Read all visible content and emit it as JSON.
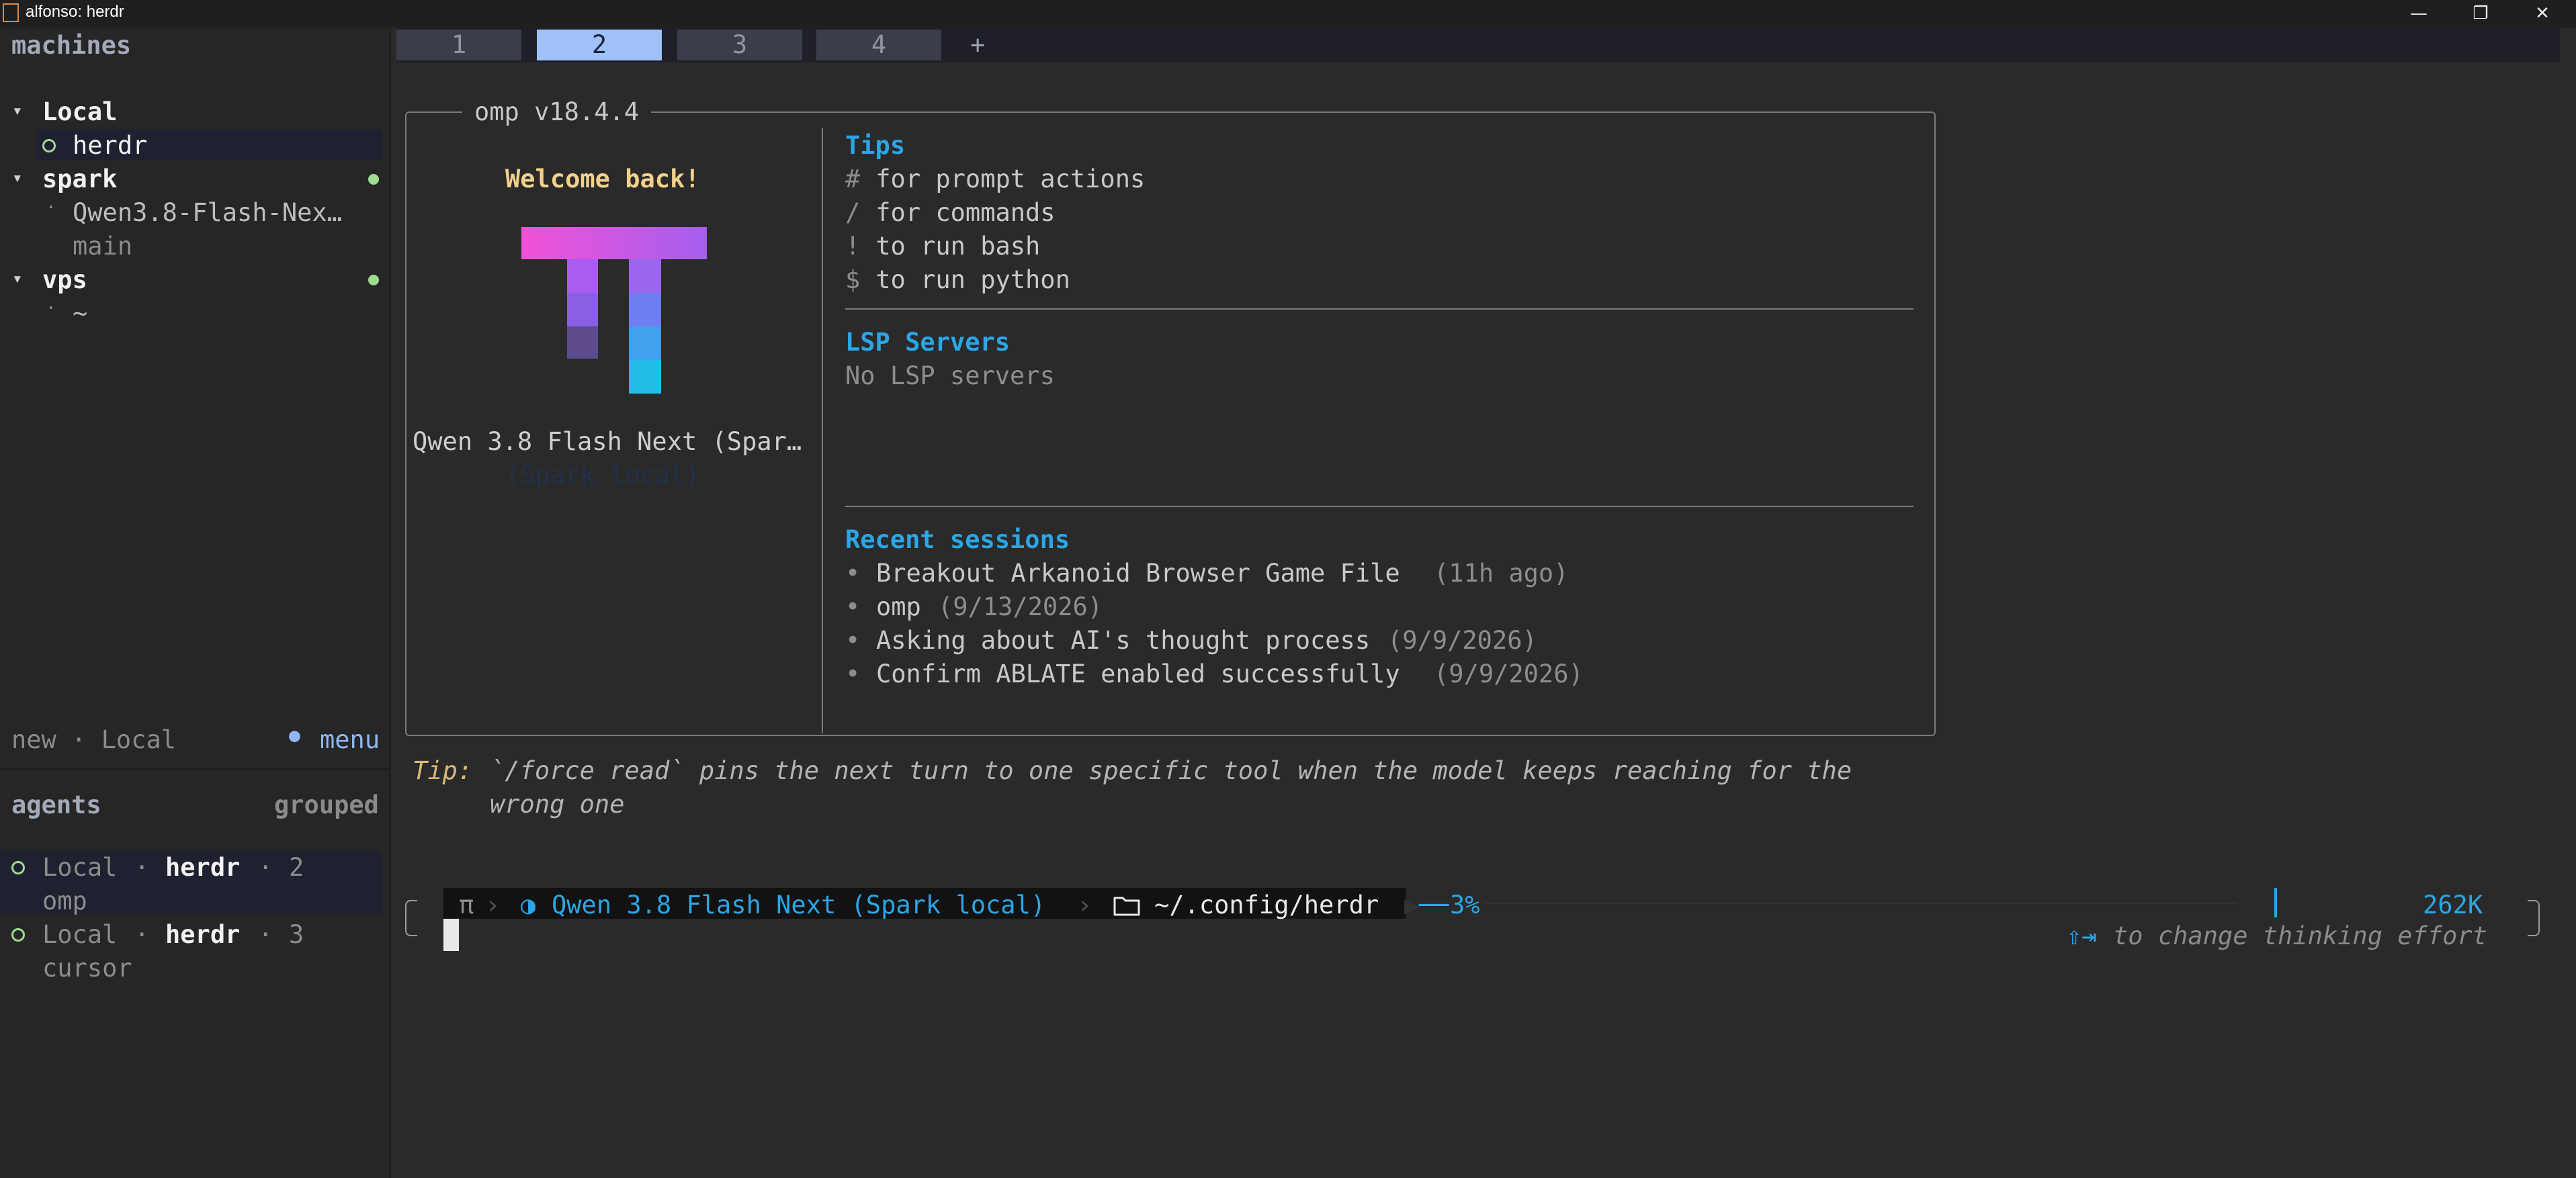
{
  "window": {
    "title": "alfonso: herdr",
    "controls": [
      "—",
      "❐",
      "✕"
    ]
  },
  "sidebar": {
    "machines_header": "machines",
    "groups": [
      {
        "caret": "▾",
        "name": "Local",
        "items": [
          {
            "glyph": "○",
            "label": "herdr"
          }
        ]
      },
      {
        "caret": "▾",
        "name": "spark",
        "items": [
          {
            "glyph": "·",
            "label": "Qwen3.8-Flash-Nex…"
          },
          {
            "glyph": "",
            "label": "main"
          }
        ]
      },
      {
        "caret": "▾",
        "name": "vps",
        "items": [
          {
            "glyph": "·",
            "label": "~"
          }
        ]
      }
    ],
    "footer": {
      "new_label": "new · Local",
      "menu_glyph": "●",
      "menu_label": "menu"
    },
    "agents_header": "agents",
    "agents_mode": "grouped",
    "agents": [
      {
        "glyph": "○",
        "machine": "Local",
        "sep": "·",
        "host": "herdr",
        "sep2": "·",
        "num": "2",
        "name": "omp"
      },
      {
        "glyph": "○",
        "machine": "Local",
        "sep": "·",
        "host": "herdr",
        "sep2": "·",
        "num": "3",
        "name": "cursor"
      }
    ]
  },
  "tabs": {
    "items": [
      "1",
      "2",
      "3",
      "4"
    ],
    "active": "2",
    "add": "+"
  },
  "panel": {
    "title": "omp v18.4.4",
    "welcome": "Welcome back!",
    "model": "Qwen 3.8 Flash Next (Spar…",
    "model_sub": "(Spark local)",
    "tips_header": "Tips",
    "tips": [
      {
        "key": "#",
        "text": " for prompt actions"
      },
      {
        "key": "/",
        "text": " for commands"
      },
      {
        "key": "!",
        "text": " to run bash"
      },
      {
        "key": "$",
        "text": " to run python"
      }
    ],
    "lsp_header": "LSP Servers",
    "lsp_text": "No LSP servers",
    "recent_header": "Recent sessions",
    "recent": [
      {
        "title": "Breakout Arkanoid Browser Game File",
        "when": "(11h ago)"
      },
      {
        "title": "omp",
        "when": "(9/13/2026)"
      },
      {
        "title": "Asking about AI's thought process",
        "when": "(9/9/2026)"
      },
      {
        "title": "Confirm ABLATE enabled successfully",
        "when": "(9/9/2026)"
      }
    ]
  },
  "tip": {
    "label": "Tip:",
    "line1": "`/force read` pins the next turn to one specific tool when the model keeps reaching for the",
    "line2": "wrong one"
  },
  "prompt": {
    "pi": "π",
    "model": "Qwen 3.8 Flash Next (Spark local)",
    "path": "~/.config/herdr",
    "context": "3%",
    "tokens": "262K",
    "hint_keys": "⇧⇥",
    "hint": "to change thinking effort"
  },
  "colors": {
    "accent_cyan": "#2ba6e6",
    "active_tab": "#9fc1f7",
    "status_green": "#9fdc8f",
    "welcome": "#f2d18c"
  }
}
